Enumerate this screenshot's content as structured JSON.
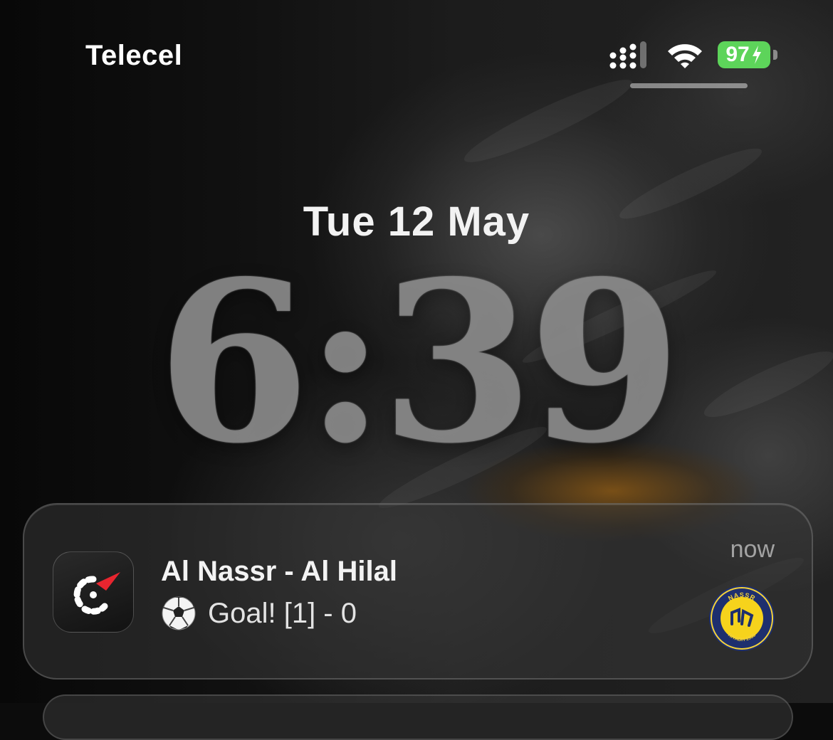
{
  "status_bar": {
    "carrier": "Telecel",
    "battery_level": "97",
    "battery_color": "#5dd45a",
    "signal_icon": "cellular-signal-icon",
    "wifi_icon": "wifi-icon",
    "charging_icon": "bolt-icon"
  },
  "lock_screen": {
    "date": "Tue 12 May",
    "time": "6:39"
  },
  "notification": {
    "app_icon": "sports-app-icon",
    "title": "Al Nassr - Al Hilal",
    "emoji": "⚽",
    "body": "Goal! [1] - 0",
    "time": "now",
    "badge_icon": "al-nassr-crest-icon",
    "badge_text_top": "NASSR",
    "badge_text_bottom": "RIYADH 1955"
  }
}
